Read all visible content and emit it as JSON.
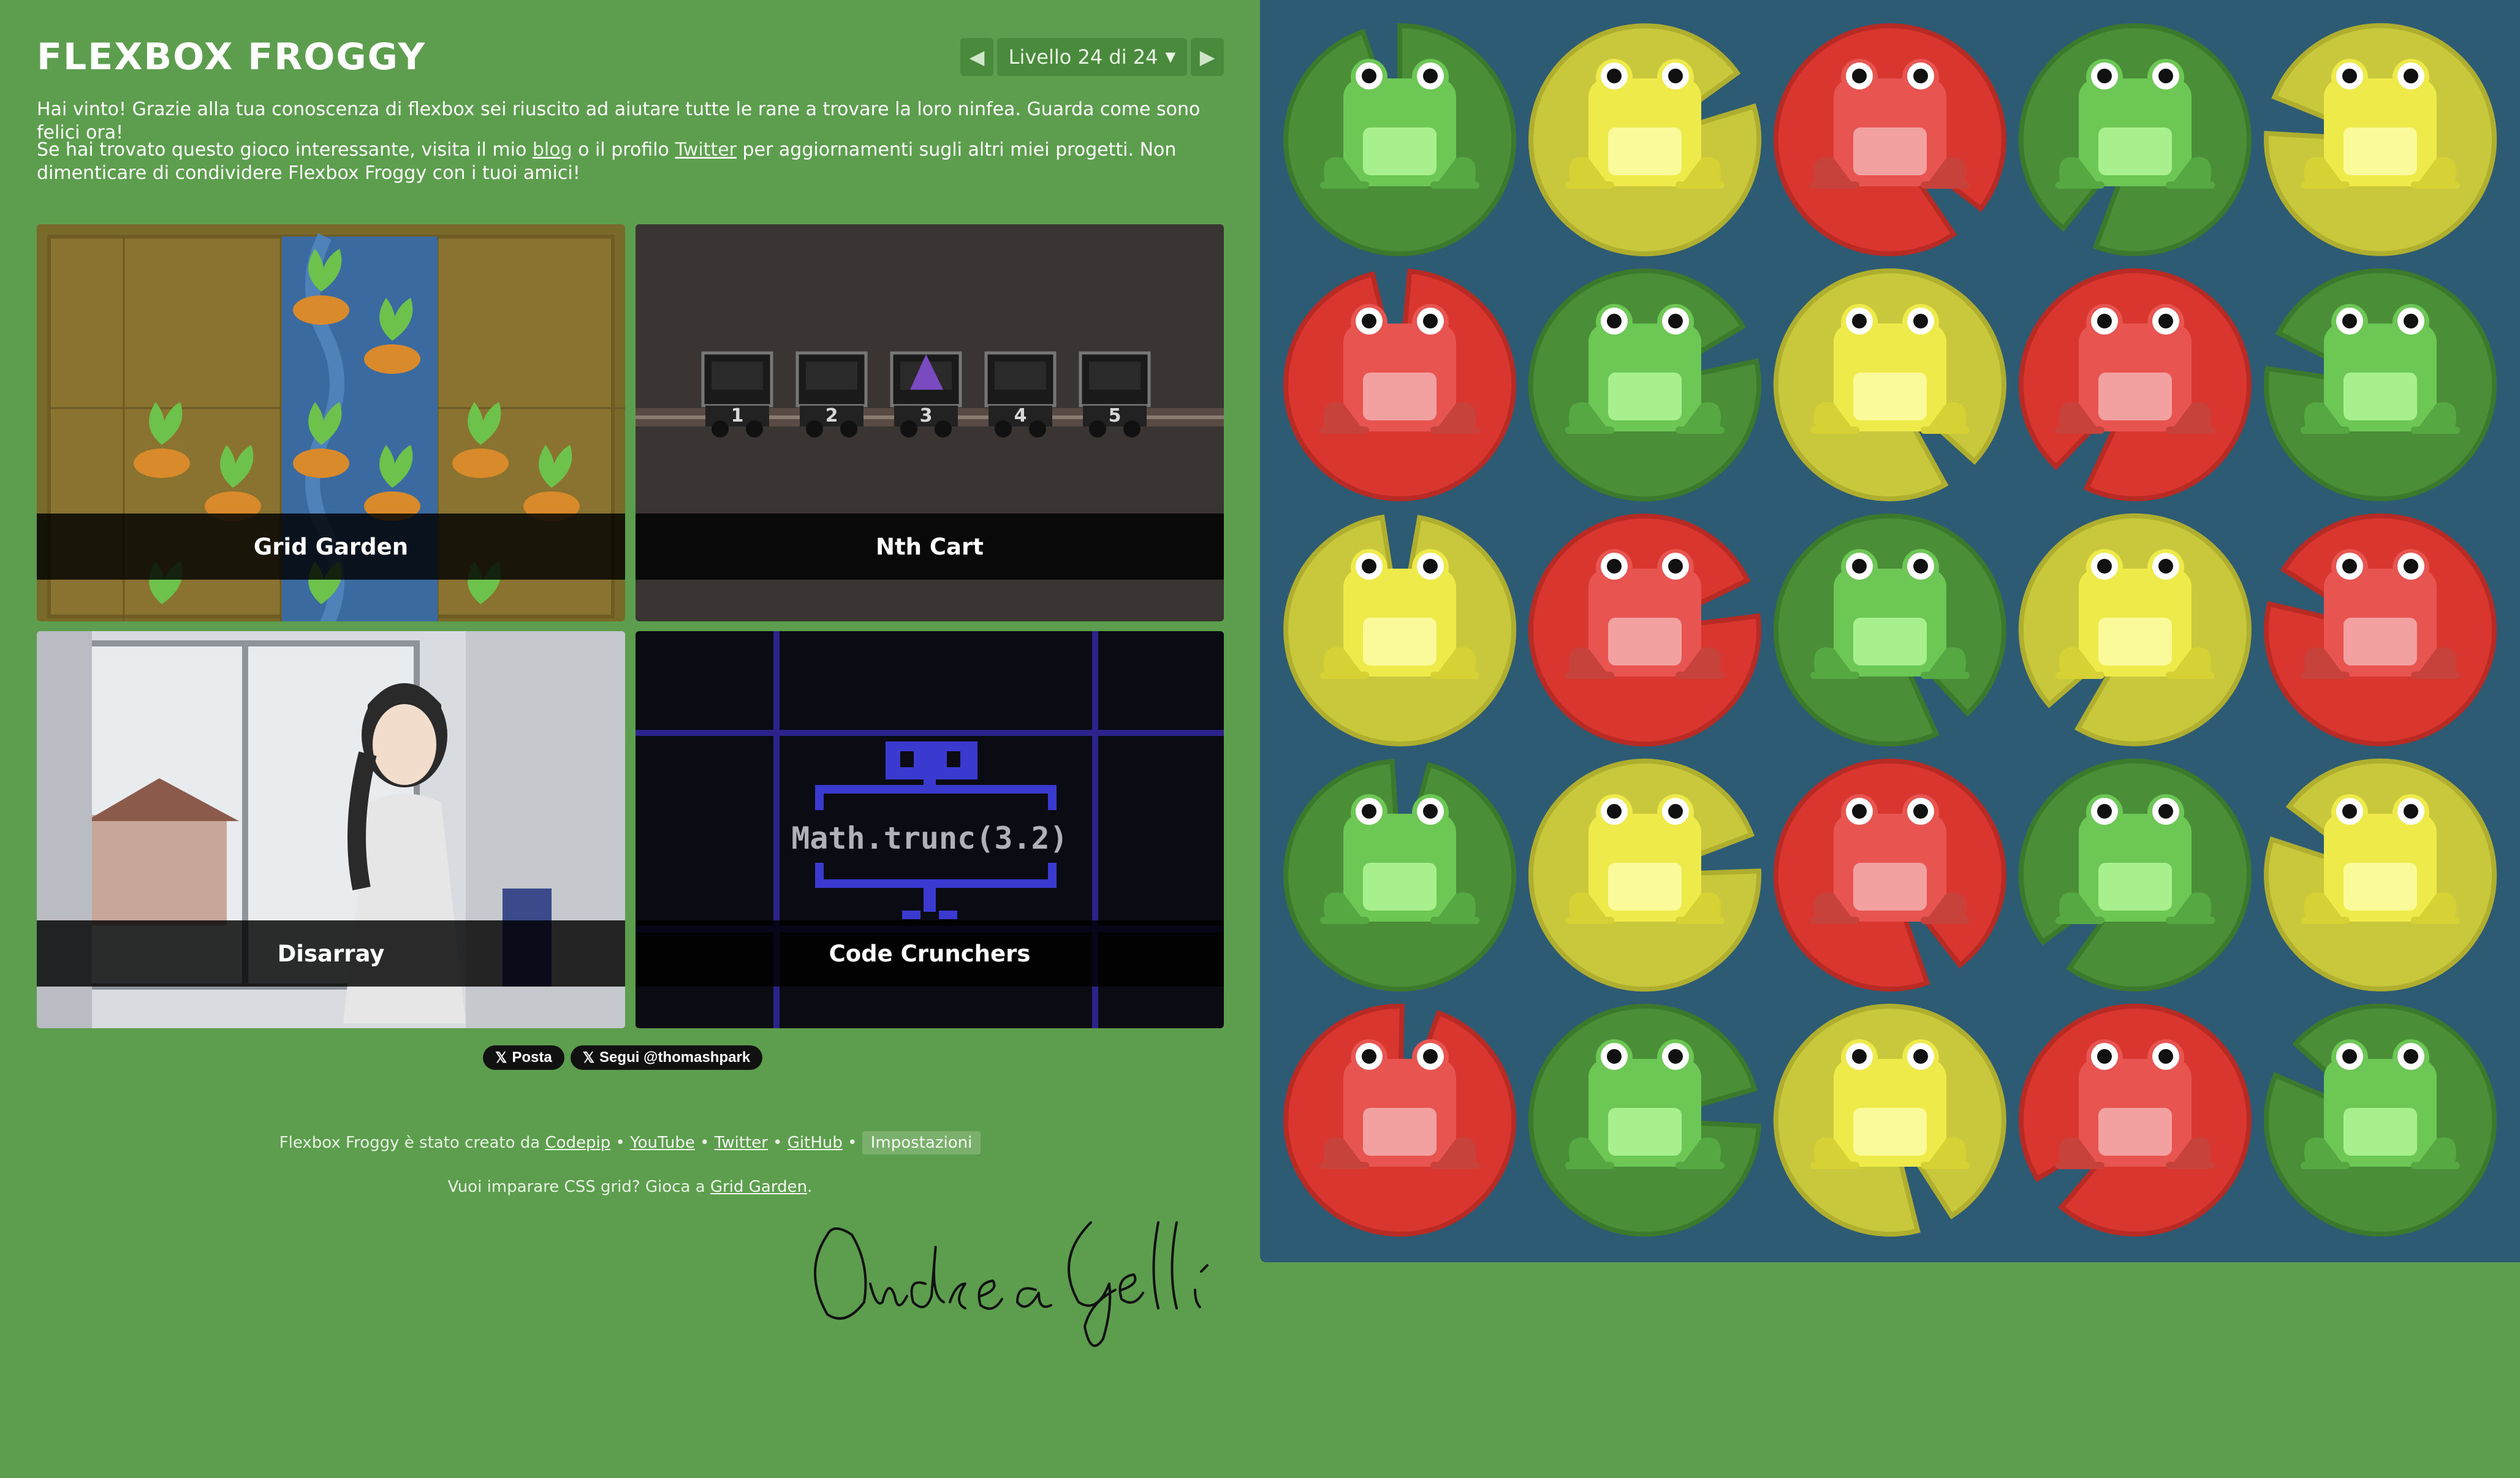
{
  "header": {
    "title": "Flexbox Froggy",
    "level_label": "Livello 24 di 24",
    "prev_icon": "triangle-left",
    "next_icon": "triangle-right",
    "dropdown_icon": "caret-down"
  },
  "win_message": "Hai vinto! Grazie alla tua conoscenza di flexbox sei riuscito ad aiutare tutte le rane a trovare la loro ninfea. Guarda come sono felici ora!",
  "promo": {
    "before_blog": "Se hai trovato questo gioco interessante, visita il mio ",
    "blog_link": "blog",
    "between": " o il profilo ",
    "twitter_link": "Twitter",
    "after": " per aggiornamenti sugli altri miei progetti. Non dimenticare di condividere Flexbox Froggy con i tuoi amici!"
  },
  "games": [
    {
      "label": "Grid Garden"
    },
    {
      "label": "Nth Cart",
      "cart_numbers": [
        "1",
        "2",
        "3",
        "4",
        "5"
      ]
    },
    {
      "label": "Disarray"
    },
    {
      "label": "Code Crunchers",
      "code": "Math.trunc(3.2)"
    }
  ],
  "share": {
    "post_label": "Posta",
    "follow_label": "Segui @thomashpark"
  },
  "footer": {
    "credit_text": "Flexbox Froggy è stato creato da ",
    "codepip": "Codepip",
    "youtube": "YouTube",
    "twitter": "Twitter",
    "github": "GitHub",
    "settings": "Impostazioni",
    "separator": " • ",
    "css_grid_text": "Vuoi imparare CSS grid? Gioca a ",
    "grid_garden_link": "Grid Garden",
    "css_grid_end": "."
  },
  "signature": "Andrea Gelli",
  "pond": {
    "rows": [
      [
        "green",
        "yellow",
        "red",
        "green",
        "yellow"
      ],
      [
        "red",
        "green",
        "yellow",
        "red",
        "green"
      ],
      [
        "yellow",
        "red",
        "green",
        "yellow",
        "red"
      ],
      [
        "green",
        "yellow",
        "red",
        "green",
        "yellow"
      ],
      [
        "red",
        "green",
        "yellow",
        "red",
        "green"
      ]
    ]
  },
  "colors": {
    "background": "#5d9e4e",
    "pond": "#2c5b73",
    "green_pad": "#4a8f38",
    "yellow_pad": "#c9c73c",
    "red_pad": "#d8362e"
  }
}
